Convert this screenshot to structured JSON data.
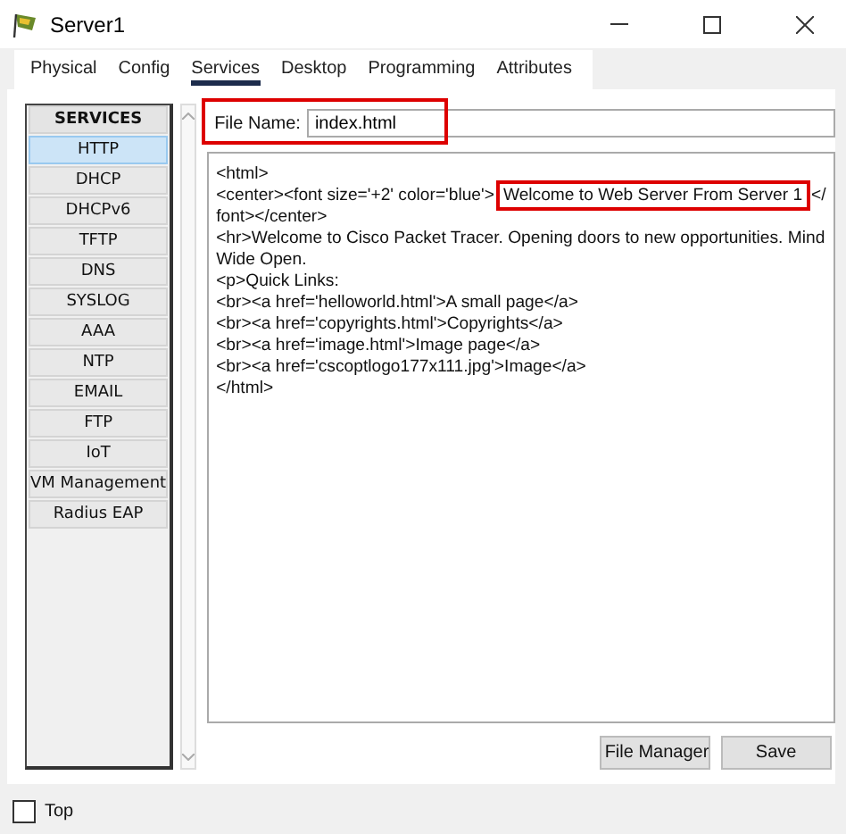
{
  "window": {
    "title": "Server1"
  },
  "tabs": [
    {
      "label": "Physical",
      "selected": false
    },
    {
      "label": "Config",
      "selected": false
    },
    {
      "label": "Services",
      "selected": true
    },
    {
      "label": "Desktop",
      "selected": false
    },
    {
      "label": "Programming",
      "selected": false
    },
    {
      "label": "Attributes",
      "selected": false
    }
  ],
  "services": {
    "header": "SERVICES",
    "items": [
      {
        "label": "HTTP",
        "selected": true
      },
      {
        "label": "DHCP",
        "selected": false
      },
      {
        "label": "DHCPv6",
        "selected": false
      },
      {
        "label": "TFTP",
        "selected": false
      },
      {
        "label": "DNS",
        "selected": false
      },
      {
        "label": "SYSLOG",
        "selected": false
      },
      {
        "label": "AAA",
        "selected": false
      },
      {
        "label": "NTP",
        "selected": false
      },
      {
        "label": "EMAIL",
        "selected": false
      },
      {
        "label": "FTP",
        "selected": false
      },
      {
        "label": "IoT",
        "selected": false
      },
      {
        "label": "VM Management",
        "selected": false
      },
      {
        "label": "Radius EAP",
        "selected": false
      }
    ]
  },
  "file_name": {
    "label": "File Name:",
    "value": "index.html",
    "highlighted": true
  },
  "editor_lines": [
    [
      {
        "text": "<html>",
        "highlighted": false
      }
    ],
    [
      {
        "text": "<center><font size='+2' color='blue'>",
        "highlighted": false
      },
      {
        "text": "Welcome to Web Server From Server 1",
        "highlighted": true
      },
      {
        "text": "</",
        "highlighted": false
      }
    ],
    [
      {
        "text": "font></center>",
        "highlighted": false
      }
    ],
    [
      {
        "text": "<hr>Welcome to Cisco Packet Tracer. Opening doors to new opportunities. Mind",
        "highlighted": false
      }
    ],
    [
      {
        "text": "Wide Open.",
        "highlighted": false
      }
    ],
    [
      {
        "text": "<p>Quick Links:",
        "highlighted": false
      }
    ],
    [
      {
        "text": "<br><a href='helloworld.html'>A small page</a>",
        "highlighted": false
      }
    ],
    [
      {
        "text": "<br><a href='copyrights.html'>Copyrights</a>",
        "highlighted": false
      }
    ],
    [
      {
        "text": "<br><a href='image.html'>Image page</a>",
        "highlighted": false
      }
    ],
    [
      {
        "text": "<br><a href='cscoptlogo177x111.jpg'>Image</a>",
        "highlighted": false
      }
    ],
    [
      {
        "text": "</html>",
        "highlighted": false
      }
    ]
  ],
  "buttons": [
    "File Manager",
    "Save"
  ],
  "top_checkbox": {
    "label": "Top",
    "checked": false
  }
}
